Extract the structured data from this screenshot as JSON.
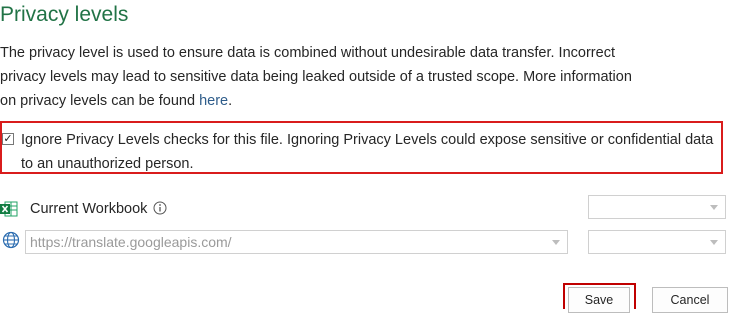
{
  "header": {
    "title": "Privacy levels"
  },
  "description": {
    "line1": "The privacy level is used to ensure data is combined without undesirable data transfer. Incorrect",
    "line2": "privacy levels may lead to sensitive data being leaked outside of a trusted scope. More information",
    "line3_prefix": "on privacy levels can be found ",
    "link_text": "here",
    "line3_suffix": "."
  },
  "ignore_option": {
    "checked": true,
    "label_line1": "Ignore Privacy Levels checks for this file. Ignoring Privacy Levels could expose sensitive or confidential data",
    "label_line2": "to an unauthorized person."
  },
  "sources": [
    {
      "icon": "excel-icon",
      "name": "Current Workbook",
      "has_info_icon": true,
      "privacy_level": ""
    },
    {
      "icon": "globe-icon",
      "name": "https://translate.googleapis.com/",
      "privacy_level": ""
    }
  ],
  "buttons": {
    "save": "Save",
    "cancel": "Cancel"
  },
  "colors": {
    "title": "#217346",
    "highlight": "#d91c1c",
    "link": "#2e5c8a"
  }
}
